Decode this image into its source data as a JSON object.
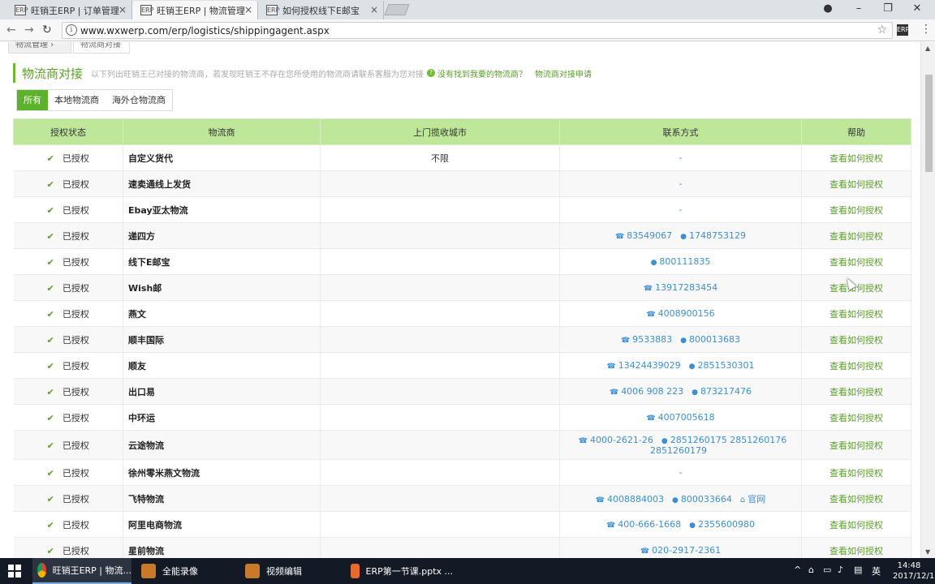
{
  "browser": {
    "tabs": [
      {
        "label": "旺销王ERP | 订单管理",
        "active": false
      },
      {
        "label": "旺销王ERP | 物流管理",
        "active": true
      },
      {
        "label": "如何授权线下E邮宝",
        "active": false
      }
    ],
    "url": "www.wxwerp.com/erp/logistics/shippingagent.aspx"
  },
  "page": {
    "subtabs": [
      "物流管理",
      "物流商对接"
    ],
    "title": "物流商对接",
    "description": "以下列出旺销王已对接的物流商，若发现旺销王不存在您所使用的物流商请联系客服为您对接",
    "not_found_link": "没有找到我要的物流商？",
    "apply_link": "物流商对接申请",
    "filters": [
      "所有",
      "本地物流商",
      "海外仓物流商"
    ],
    "columns": [
      "授权状态",
      "物流商",
      "上门揽收城市",
      "联系方式",
      "帮助"
    ],
    "rows": [
      {
        "status": "已授权",
        "provider": "自定义货代",
        "city": "不限",
        "contact_text": "-",
        "help": "查看如何授权"
      },
      {
        "status": "已授权",
        "provider": "速卖通线上发货",
        "city": "",
        "contact_text": "-",
        "help": "查看如何授权"
      },
      {
        "status": "已授权",
        "provider": "Ebay亚太物流",
        "city": "",
        "contact_text": "-",
        "help": "查看如何授权"
      },
      {
        "status": "已授权",
        "provider": "递四方",
        "city": "",
        "phone": "83549067",
        "qq": "1748753129",
        "help": "查看如何授权"
      },
      {
        "status": "已授权",
        "provider": "线下E邮宝",
        "city": "",
        "qq": "800111835",
        "help": "查看如何授权"
      },
      {
        "status": "已授权",
        "provider": "Wish邮",
        "city": "",
        "phone": "13917283454",
        "help": "查看如何授权"
      },
      {
        "status": "已授权",
        "provider": "燕文",
        "city": "",
        "phone": "4008900156",
        "help": "查看如何授权"
      },
      {
        "status": "已授权",
        "provider": "顺丰国际",
        "city": "",
        "phone": "9533883",
        "qq": "800013683",
        "help": "查看如何授权"
      },
      {
        "status": "已授权",
        "provider": "顺友",
        "city": "",
        "phone": "13424439029",
        "qq": "2851530301",
        "help": "查看如何授权"
      },
      {
        "status": "已授权",
        "provider": "出口易",
        "city": "",
        "phone": "4006 908 223",
        "qq": "873217476",
        "help": "查看如何授权"
      },
      {
        "status": "已授权",
        "provider": "中环运",
        "city": "",
        "phone": "4007005618",
        "help": "查看如何授权"
      },
      {
        "status": "已授权",
        "provider": "云途物流",
        "city": "",
        "phone": "4000-2621-26",
        "qq": "2851260175 2851260176 2851260179",
        "help": "查看如何授权",
        "tall": true
      },
      {
        "status": "已授权",
        "provider": "徐州零米燕文物流",
        "city": "",
        "contact_text": "-",
        "help": "查看如何授权"
      },
      {
        "status": "已授权",
        "provider": "飞特物流",
        "city": "",
        "phone": "4008884003",
        "qq": "800033664",
        "site": "官网",
        "help": "查看如何授权"
      },
      {
        "status": "已授权",
        "provider": "阿里电商物流",
        "city": "",
        "phone": "400-666-1668",
        "qq": "2355600980",
        "help": "查看如何授权"
      },
      {
        "status": "已授权",
        "provider": "星前物流",
        "city": "",
        "phone": "020-2917-2361",
        "help": "查看如何授权"
      }
    ]
  },
  "taskbar": {
    "items": [
      {
        "label": "旺销王ERP | 物流...",
        "color": "#e8b400",
        "active": true
      },
      {
        "label": "全能录像",
        "color": "#c87a2a",
        "active": false
      },
      {
        "label": "视频编辑",
        "color": "#c87a2a",
        "active": false
      },
      {
        "label": "ERP第一节课.pptx ...",
        "color": "#e66a2c",
        "active": false
      }
    ],
    "ime": "英",
    "time": "14:48",
    "date": "2017/12/1"
  }
}
